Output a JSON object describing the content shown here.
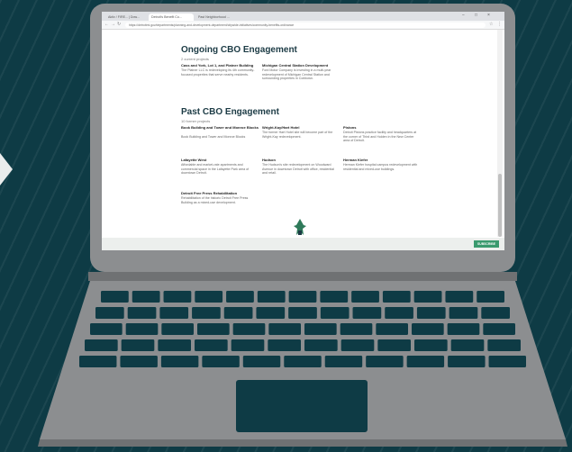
{
  "browser": {
    "tabs": [
      {
        "label": "Aktiv / FIRE... | Dow..."
      },
      {
        "label": "Detroit's Benefit Co..."
      },
      {
        "label": "Past Neighborhood ..."
      }
    ],
    "address": "https://detroitmi.gov/departments/planning-and-development-department/citywide-initiatives/community-benefits-ordinance"
  },
  "ongoing": {
    "heading": "Ongoing CBO Engagement",
    "count": "2 current projects",
    "cards": [
      {
        "title": "Cass and York, Lot 1, and Platner Building",
        "body": "The Platner LLC is redeveloping its 4th community-focused properties that serve nearby residents."
      },
      {
        "title": "Michigan Central Station Development",
        "body": "Ford Motor Company is investing in a multi-year redevelopment of Michigan Central Station and surrounding properties in Corktown."
      }
    ]
  },
  "past": {
    "heading": "Past CBO Engagement",
    "count": "10 former projects",
    "cards": [
      {
        "title": "Book Building and Tower and Monroe Blocks",
        "body": "Book Building and Tower and Monroe Blocks"
      },
      {
        "title": "Wright-Kay/Hart Hotel",
        "body": "The former Hart Hotel site will become part of the Wright-Kay redevelopment."
      },
      {
        "title": "Pistons",
        "body": "Detroit Pistons practice facility and headquarters at the corner of Third and Holden in the New Center area of Detroit."
      },
      {
        "title": "Lafayette West",
        "body": "Affordable and market-rate apartments and commercial space in the Lafayette Park area of downtown Detroit."
      },
      {
        "title": "Hudson",
        "body": "The Hudson's site redevelopment on Woodward Avenue in downtown Detroit with office, residential and retail."
      },
      {
        "title": "Herman Kiefer",
        "body": "Herman Kiefer hospital campus redevelopment with residential and mixed-use buildings."
      },
      {
        "title": "Detroit Free Press Rehabilitation",
        "body": "Rehabilitation of the historic Detroit Free Press Building as a mixed-use development."
      }
    ]
  },
  "footer": {
    "button_label": "SUBSCRIBE"
  },
  "colors": {
    "background": "#0e3b45",
    "laptop": "#8c8e90",
    "heading": "#1c3b45",
    "accent": "#3a9a6e"
  },
  "icons": [
    "back-arrow-icon",
    "forward-arrow-icon",
    "refresh-icon",
    "star-icon",
    "menu-icon",
    "city-logo-icon",
    "play-arrow-icon"
  ]
}
